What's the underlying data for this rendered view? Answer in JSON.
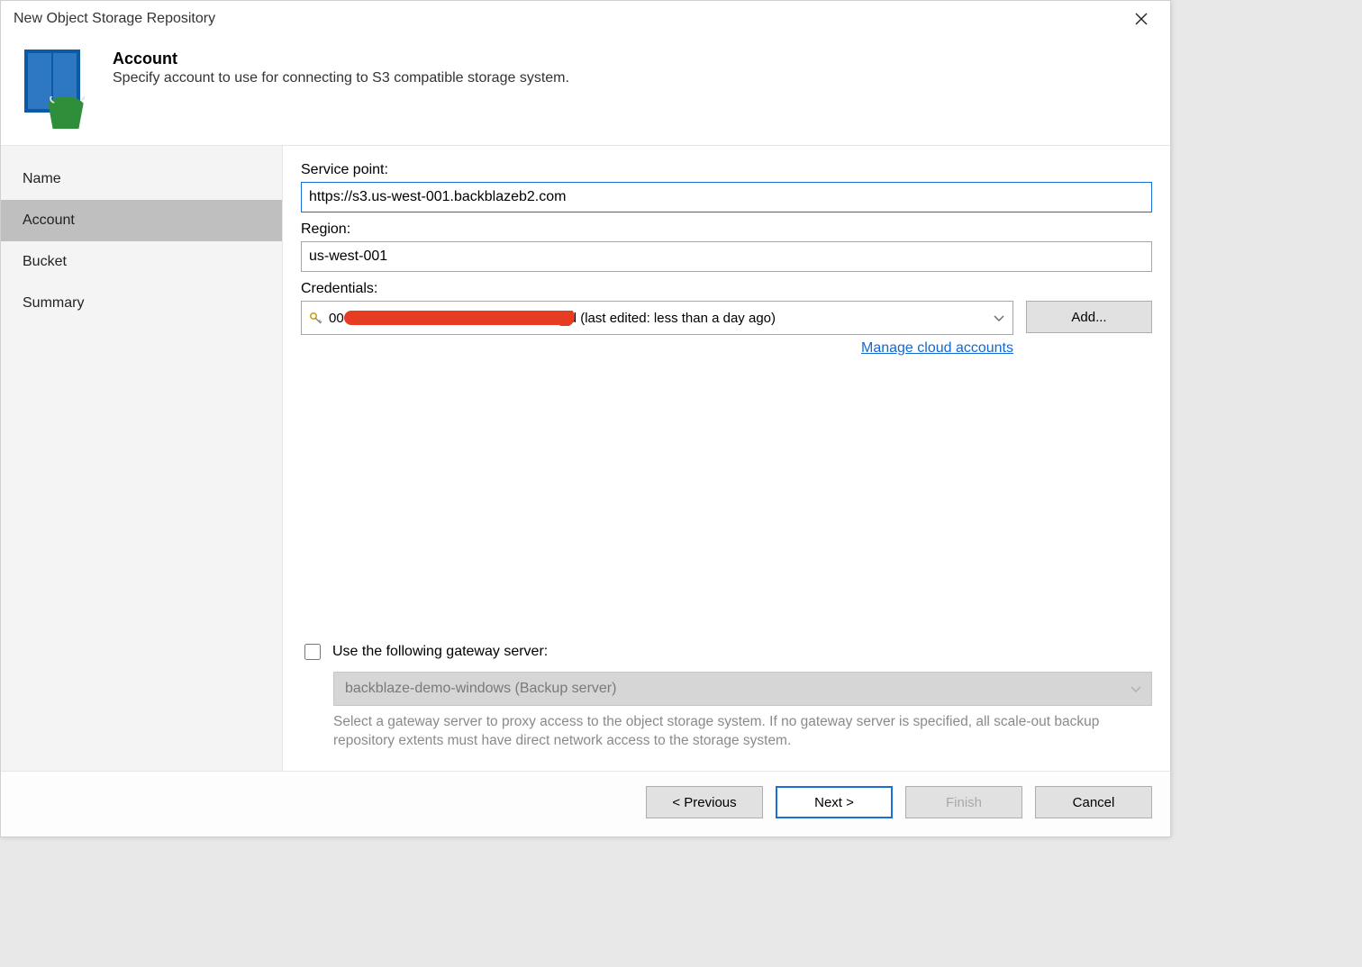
{
  "window": {
    "title": "New Object Storage Repository"
  },
  "header": {
    "heading": "Account",
    "subtext": "Specify account to use for connecting to S3 compatible storage system."
  },
  "sidebar": {
    "items": [
      {
        "label": "Name",
        "active": false
      },
      {
        "label": "Account",
        "active": true
      },
      {
        "label": "Bucket",
        "active": false
      },
      {
        "label": "Summary",
        "active": false
      }
    ]
  },
  "form": {
    "service_point_label": "Service point:",
    "service_point_value": "https://s3.us-west-001.backblazeb2.com",
    "region_label": "Region:",
    "region_value": "us-west-001",
    "credentials_label": "Credentials:",
    "credentials_prefix": "00",
    "credentials_suffix": "d (last edited: less than a day ago)",
    "add_button": "Add...",
    "manage_link": "Manage cloud accounts",
    "gateway_checkbox_label": "Use the following gateway server:",
    "gateway_select_value": "backblaze-demo-windows (Backup server)",
    "gateway_help": "Select a gateway server to proxy access to the object storage system. If no gateway server is specified, all scale-out backup repository extents must have direct network access to the storage system."
  },
  "footer": {
    "previous": "< Previous",
    "next": "Next >",
    "finish": "Finish",
    "cancel": "Cancel"
  }
}
